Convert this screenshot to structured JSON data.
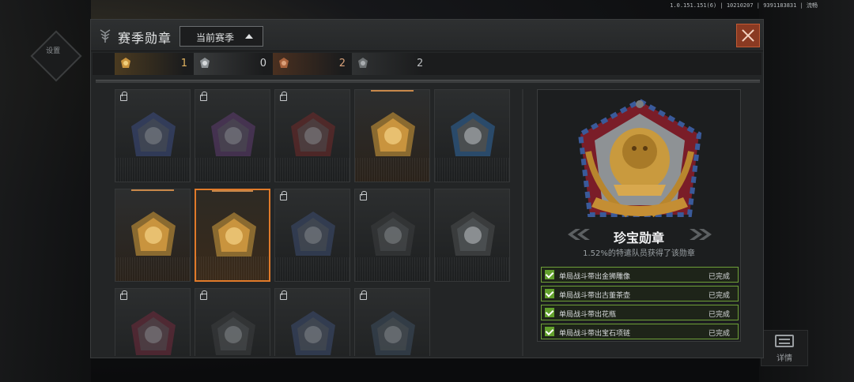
{
  "background": {
    "left_button_label": "设置"
  },
  "version_text": "1.0.151.151(6) | 10210207 | 9391183831 | 流畅",
  "detail_button_label": "详情",
  "header": {
    "title": "赛季勋章",
    "season_select": "当前赛季",
    "close_icon": "close-icon"
  },
  "stats": [
    {
      "icon": "gold-medal-icon",
      "count": "1",
      "color": "#e3b560"
    },
    {
      "icon": "silver-medal-icon",
      "count": "0",
      "color": "#d0d3d5"
    },
    {
      "icon": "bronze-medal-icon",
      "count": "2",
      "color": "#d8a27a"
    },
    {
      "icon": "gray-medal-icon",
      "count": "2",
      "color": "#b9bcbe"
    }
  ],
  "medals": [
    {
      "locked": true,
      "tier": "gray",
      "icon": "crossed-sword-medal-icon"
    },
    {
      "locked": true,
      "tier": "gray",
      "icon": "crossed-rifles-medal-icon"
    },
    {
      "locked": true,
      "tier": "gray",
      "icon": "red-emblem-medal-icon"
    },
    {
      "locked": false,
      "tier": "gold",
      "icon": "shield-swords-medal-icon"
    },
    {
      "locked": false,
      "tier": "gray",
      "icon": "tank-medal-icon"
    },
    {
      "locked": false,
      "tier": "gold",
      "icon": "treasure-chest-medal-icon"
    },
    {
      "locked": false,
      "tier": "gold",
      "icon": "lion-medal-icon",
      "selected": true
    },
    {
      "locked": true,
      "tier": "gray",
      "icon": "armored-medal-icon"
    },
    {
      "locked": true,
      "tier": "gray",
      "icon": "cannon-medal-icon"
    },
    {
      "locked": false,
      "tier": "gray",
      "icon": "eagle-medal-icon"
    },
    {
      "locked": true,
      "tier": "gray",
      "icon": "winged-medal-icon"
    },
    {
      "locked": true,
      "tier": "gray",
      "icon": "helmet-medal-icon"
    },
    {
      "locked": true,
      "tier": "gray",
      "icon": "badge-medal-icon"
    },
    {
      "locked": true,
      "tier": "gray",
      "icon": "compass-medal-icon"
    }
  ],
  "detail": {
    "name": "珍宝勋章",
    "rate": "1.52%的特遣队员获得了该勋章",
    "tasks": [
      {
        "name": "单局战斗带出金狮雕像",
        "status": "已完成"
      },
      {
        "name": "单局战斗带出古董茶壶",
        "status": "已完成"
      },
      {
        "name": "单局战斗带出花瓶",
        "status": "已完成"
      },
      {
        "name": "单局战斗带出宝石项链",
        "status": "已完成"
      }
    ]
  }
}
